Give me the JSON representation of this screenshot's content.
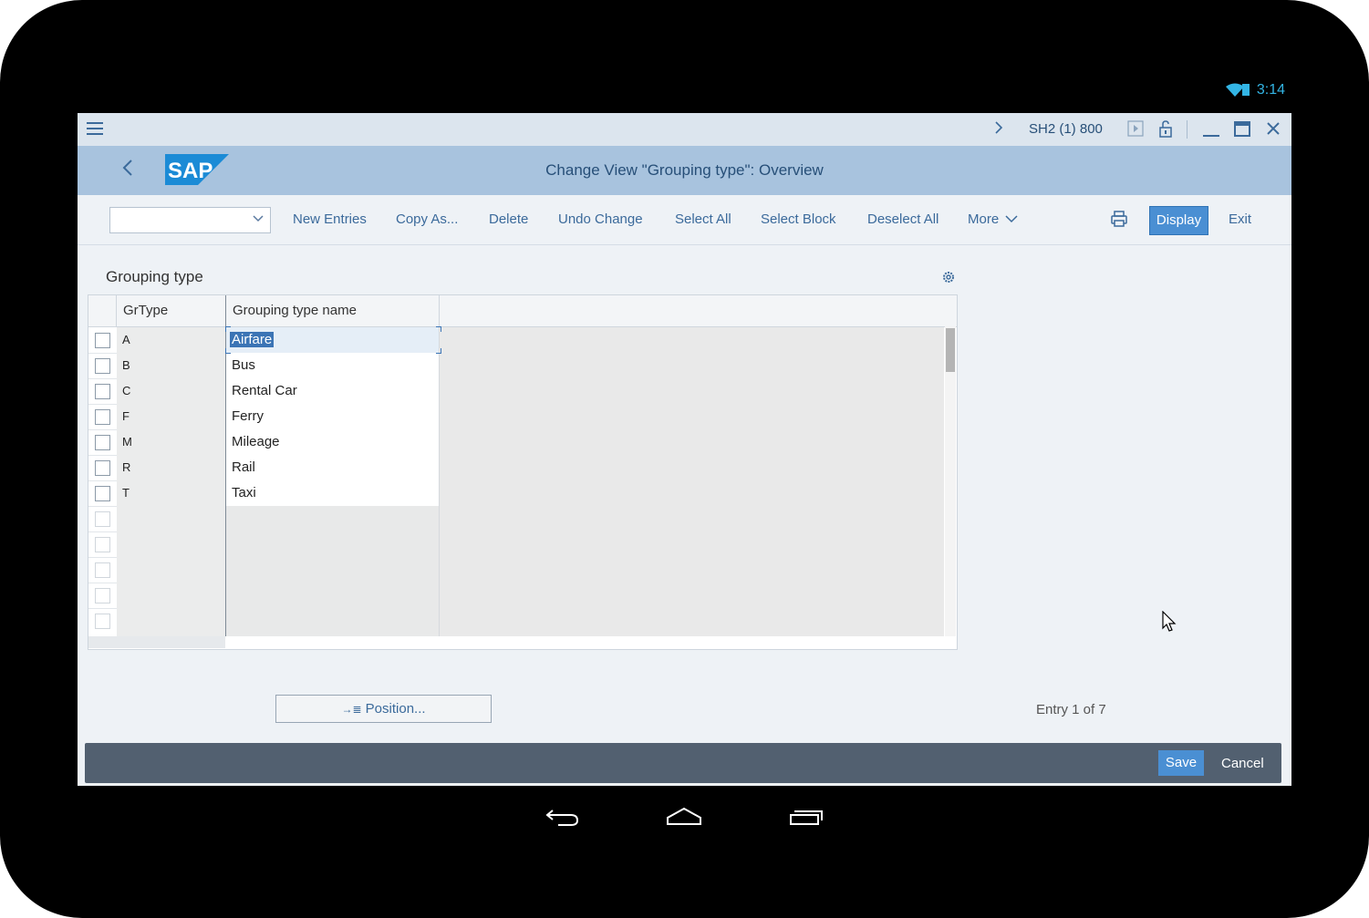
{
  "status_bar": {
    "time": "3:14"
  },
  "topbar": {
    "system_info": "SH2 (1) 800"
  },
  "header": {
    "title": "Change View \"Grouping type\": Overview",
    "logo_text": "SAP"
  },
  "toolbar": {
    "combo_value": "",
    "buttons": [
      "New Entries",
      "Copy As...",
      "Delete",
      "Undo Change",
      "Select All",
      "Select Block",
      "Deselect All",
      "More"
    ],
    "display_label": "Display",
    "exit_label": "Exit"
  },
  "table": {
    "section_title": "Grouping type",
    "columns": [
      "GrType",
      "Grouping type name"
    ],
    "rows": [
      {
        "key": "A",
        "name": "Airfare"
      },
      {
        "key": "B",
        "name": "Bus"
      },
      {
        "key": "C",
        "name": "Rental Car"
      },
      {
        "key": "F",
        "name": "Ferry"
      },
      {
        "key": "M",
        "name": "Mileage"
      },
      {
        "key": "R",
        "name": "Rail"
      },
      {
        "key": "T",
        "name": "Taxi"
      }
    ]
  },
  "footer": {
    "position_label": "Position...",
    "entry_info": "Entry 1 of 7",
    "save_label": "Save",
    "cancel_label": "Cancel"
  },
  "colors": {
    "accent": "#4a8fd3",
    "titlebar": "#a8c3de",
    "footer_bar": "#526070",
    "android_accent": "#33b5e5"
  },
  "icons": [
    "wifi-icon",
    "battery-icon",
    "hamburger-icon",
    "chevron-right-icon",
    "play-icon",
    "lock-icon",
    "minimize-icon",
    "maximize-icon",
    "close-icon",
    "back-icon",
    "print-icon",
    "settings-icon",
    "android-back-icon",
    "android-home-icon",
    "android-recents-icon"
  ]
}
